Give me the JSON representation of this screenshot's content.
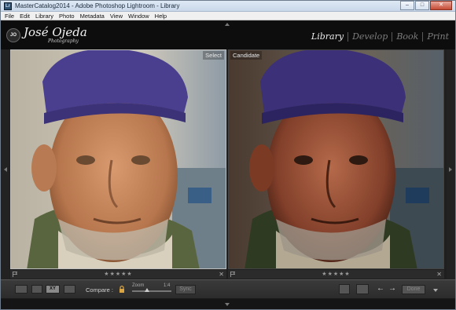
{
  "window": {
    "title": "MasterCatalog2014 - Adobe Photoshop Lightroom - Library",
    "app_icon_text": "Lr",
    "minimize": "–",
    "maximize": "□",
    "close": "✕"
  },
  "menu": {
    "items": [
      "File",
      "Edit",
      "Library",
      "Photo",
      "Metadata",
      "View",
      "Window",
      "Help"
    ]
  },
  "identity_plate": {
    "badge": "JO",
    "name": "José Ojeda",
    "subtitle": "Photography"
  },
  "modules": {
    "items": [
      "Library",
      "Develop",
      "Book",
      "Print"
    ],
    "active": "Library"
  },
  "compare": {
    "select_label": "Select",
    "candidate_label": "Candidate",
    "select_stars": "★★★★★",
    "candidate_stars": "★★★★★",
    "close_glyph": "✕"
  },
  "toolbar": {
    "compare_label": "Compare :",
    "zoom_label": "Zoom",
    "zoom_value": "1:4",
    "sync_label": "Sync",
    "view_xy_label": "XY",
    "prev_glyph": "←",
    "next_glyph": "→",
    "done_label": "Done"
  },
  "icons": {
    "lock": "lock-icon",
    "flag": "flag-icon",
    "grid": "grid-view-icon",
    "loupe": "loupe-view-icon",
    "survey": "survey-view-icon",
    "swap": "swap-icon",
    "make_select": "make-select-icon"
  },
  "colors": {
    "background": "#1a1a1a",
    "active_module": "#eeeeee",
    "inactive_module": "#7c7c7c",
    "select_border": "#bfbfbf"
  }
}
